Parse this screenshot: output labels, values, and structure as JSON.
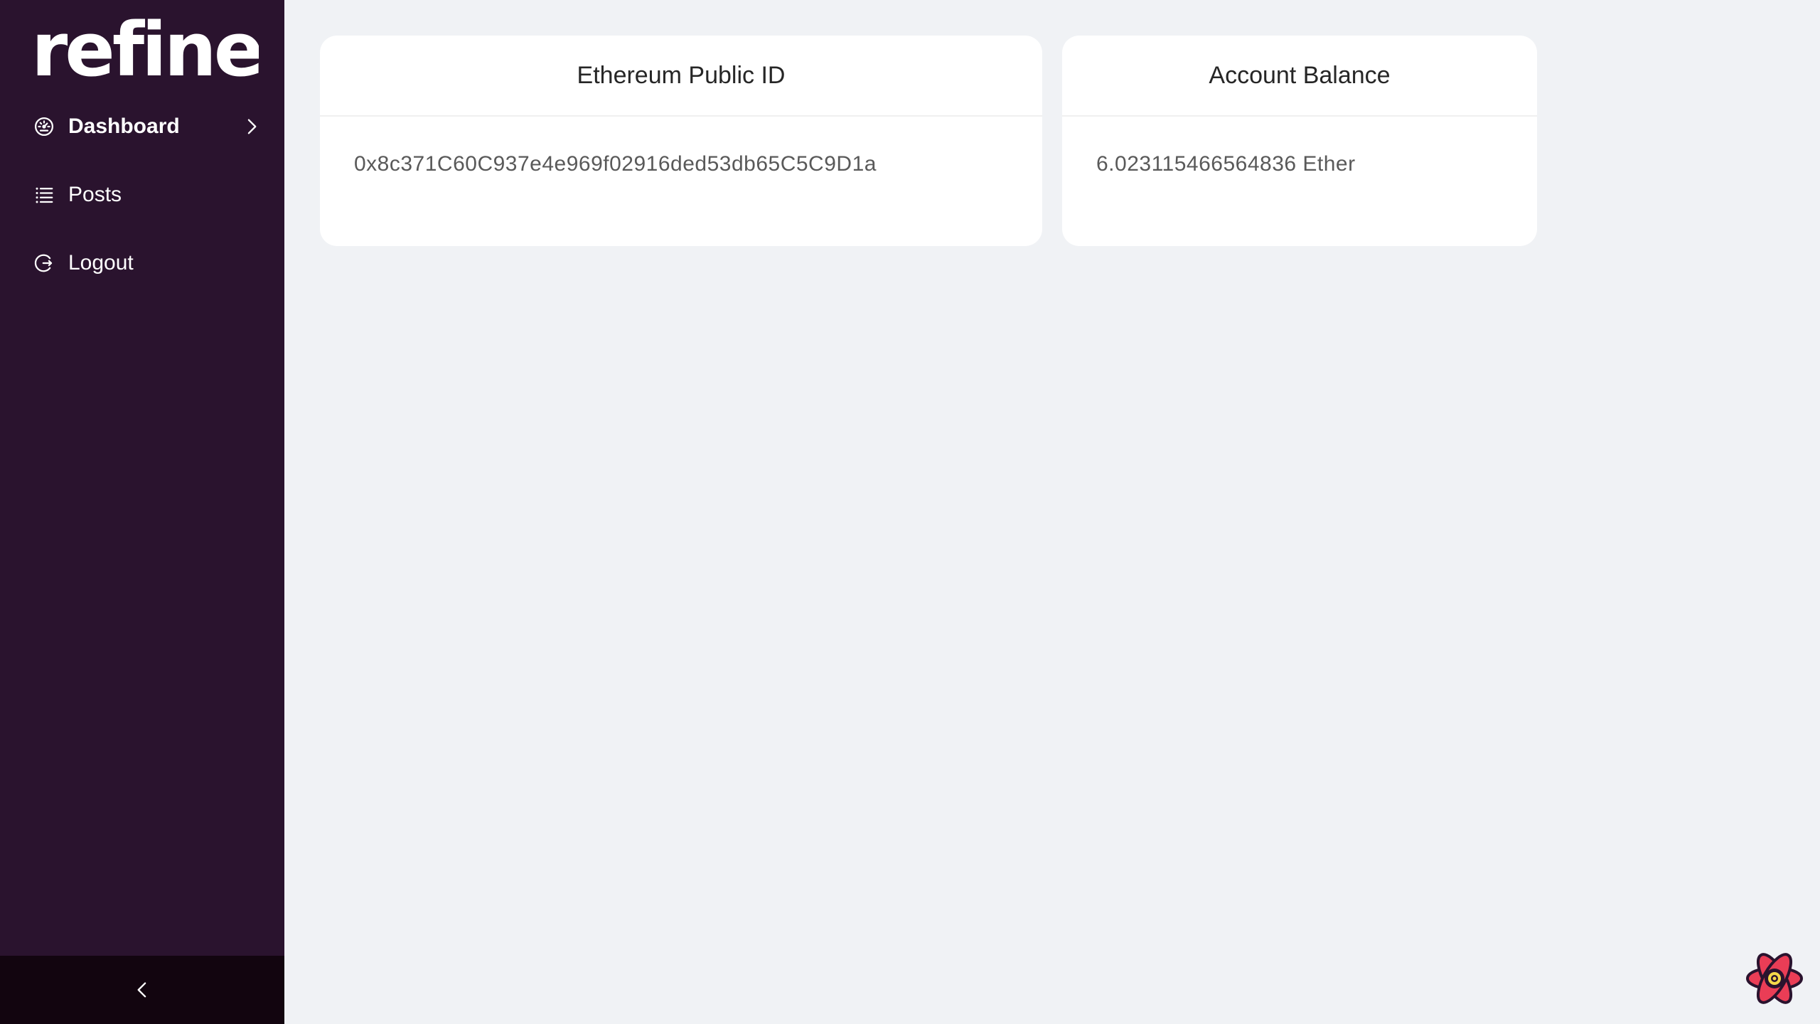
{
  "app": {
    "logo_text": "refine"
  },
  "sidebar": {
    "items": [
      {
        "label": "Dashboard",
        "icon": "dashboard-icon",
        "active": true
      },
      {
        "label": "Posts",
        "icon": "list-icon",
        "active": false
      },
      {
        "label": "Logout",
        "icon": "logout-icon",
        "active": false
      }
    ],
    "collapse_icon": "chevron-left-icon"
  },
  "cards": {
    "public_id": {
      "title": "Ethereum Public ID",
      "value": "0x8c371C60C937e4e969f02916ded53db65C5C9D1a"
    },
    "balance": {
      "title": "Account Balance",
      "value": "6.023115466564836 Ether"
    }
  },
  "devtools": {
    "icon": "react-devtools-icon"
  },
  "colors": {
    "sidebar_bg": "#2a132e",
    "collapse_bg": "#12050f",
    "page_bg": "#f0f2f5",
    "card_bg": "#ffffff",
    "devtools_red": "#ea3d56",
    "devtools_yellow": "#f5d94a"
  }
}
